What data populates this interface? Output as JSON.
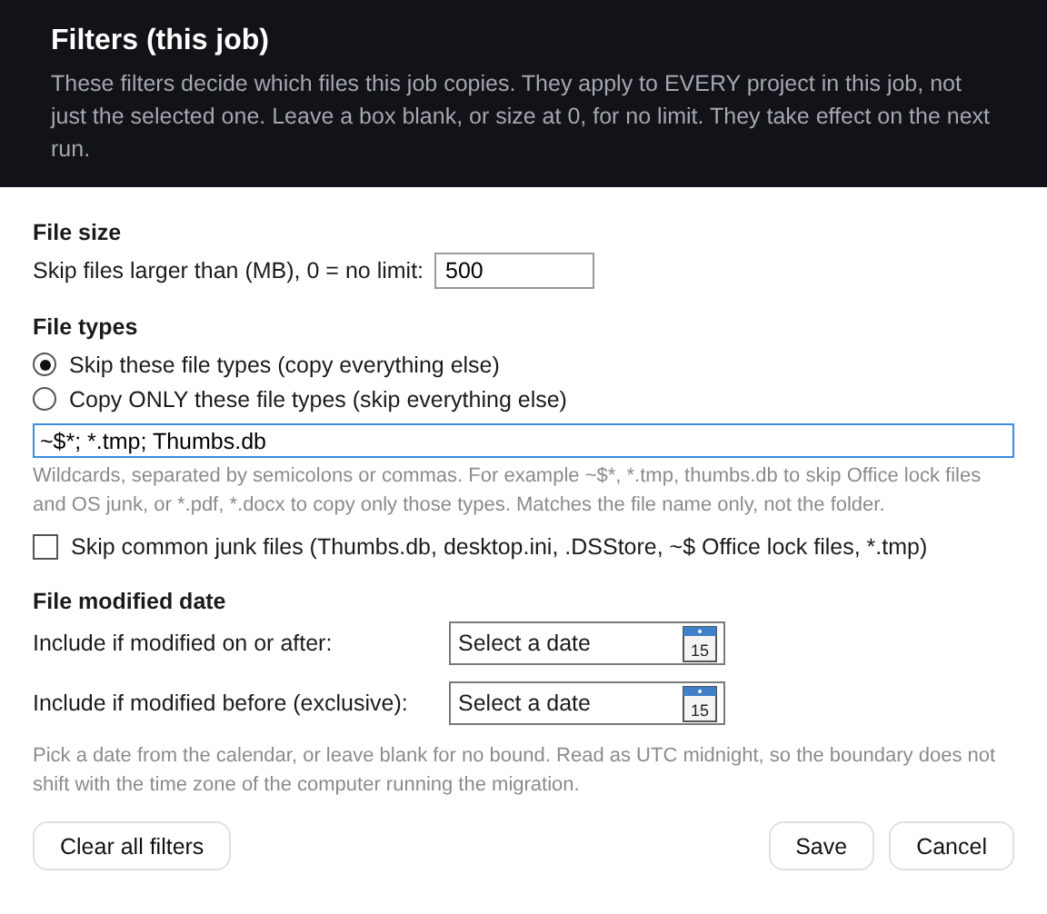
{
  "header": {
    "title": "Filters (this job)",
    "description": "These filters decide which files this job copies. They apply to EVERY project in this job, not just the selected one. Leave a box blank, or size at 0, for no limit. They take effect on the next run."
  },
  "file_size": {
    "heading": "File size",
    "label": "Skip files larger than (MB), 0 = no limit:",
    "value": "500"
  },
  "file_types": {
    "heading": "File types",
    "modes": [
      {
        "label": "Skip these file types (copy everything else)",
        "selected": true
      },
      {
        "label": "Copy ONLY these file types (skip everything else)",
        "selected": false
      }
    ],
    "value": "~$*; *.tmp; Thumbs.db",
    "focused": true,
    "hint": "Wildcards, separated by semicolons or commas. For example ~$*, *.tmp, thumbs.db to skip Office lock files and OS junk, or *.pdf, *.docx to copy only those types. Matches the file name only, not the folder.",
    "junk": {
      "label": "Skip common junk files (Thumbs.db, desktop.ini, .DSStore, ~$ Office lock files, *.tmp)",
      "checked": false
    }
  },
  "modified_date": {
    "heading": "File modified date",
    "fields": [
      {
        "label": "Include if modified on or after:",
        "placeholder": "Select a date",
        "calendar_day": "15"
      },
      {
        "label": "Include if modified before (exclusive):",
        "placeholder": "Select a date",
        "calendar_day": "15"
      }
    ],
    "hint": "Pick a date from the calendar, or leave blank for no bound. Read as UTC midnight, so the boundary does not shift with the time zone of the computer running the migration."
  },
  "buttons": {
    "left": [
      "Clear all filters"
    ],
    "right": [
      "Save",
      "Cancel"
    ]
  }
}
